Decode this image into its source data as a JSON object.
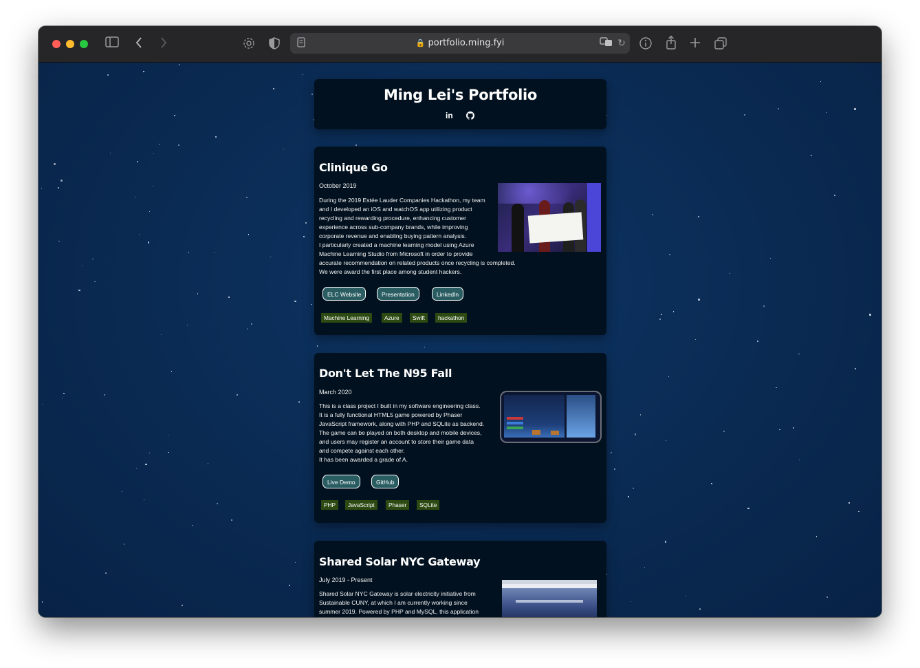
{
  "browser": {
    "url": "portfolio.ming.fyi",
    "icons": [
      "sidebar-icon",
      "back-icon",
      "forward-icon",
      "settings-icon",
      "shield-icon",
      "reader-icon",
      "lock-icon",
      "translate-icon",
      "reload-icon",
      "info-icon",
      "share-icon",
      "new-tab-icon",
      "tabs-icon"
    ],
    "colors": {
      "close": "#ff5f57",
      "minimize": "#febc2e",
      "zoom": "#28c840"
    }
  },
  "header": {
    "title": "Ming Lei's Portfolio",
    "linkedin_label": "in",
    "github_icon": "github-icon"
  },
  "projects": [
    {
      "title": "Clinique Go",
      "date": "October 2019",
      "description": "During the 2019 Estée Lauder Companies Hackathon, my team\nand I developed an iOS and watchOS app utilizing product\nrecycling and rewarding procedure, enhancing customer\nexperience across sub-company brands, while improving\ncorporate revenue and enabling buying pattern analysis.\nI particularly created a machine learning model using Azure\nMachine Learning Studio from Microsoft in order to provide\naccurate recommendation on related products once recycling is completed.\nWe were award the first place among student hackers.",
      "buttons": [
        "ELC Website",
        "Presentation",
        "LinkedIn"
      ],
      "tags": [
        "Machine Learning",
        "Azure",
        "Swift",
        "hackathon"
      ]
    },
    {
      "title": "Don't Let The N95 Fall",
      "date": "March 2020",
      "description": "This is a class project I built in my software engineering class.\nIt is a fully functional HTML5 game powered by Phaser\nJavaScript framework, along with PHP and SQLite as backend.\nThe game can be played on both desktop and mobile devices,\nand users may register an account to store their game data\nand compete against each other.\nIt has been awarded a grade of A.",
      "buttons": [
        "Live Demo",
        "GitHub"
      ],
      "tags": [
        "PHP",
        "JavaScript",
        "Phaser",
        "SQLite"
      ]
    },
    {
      "title": "Shared Solar NYC Gateway",
      "date": "July 2019 - Present",
      "description": "Shared Solar NYC Gateway is solar electricity initiative from\nSustainable CUNY, at which I am currently working since\nsummer 2019. Powered by PHP and MySQL, this application"
    }
  ]
}
